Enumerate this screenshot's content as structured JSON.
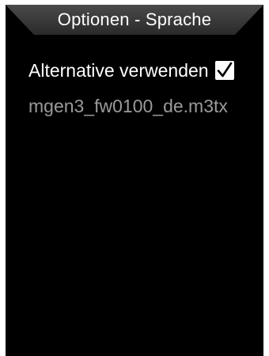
{
  "header": {
    "title": "Optionen - Sprache"
  },
  "options": {
    "alternative_label": "Alternative verwenden",
    "alternative_checked": true,
    "checkbox_icon": "checkmark-icon"
  },
  "file": {
    "name": "mgen3_fw0100_de.m3tx"
  },
  "colors": {
    "background": "#000000",
    "title_bar": "#3a3a3a",
    "text_primary": "#ffffff",
    "text_secondary": "#9a9a9a"
  }
}
